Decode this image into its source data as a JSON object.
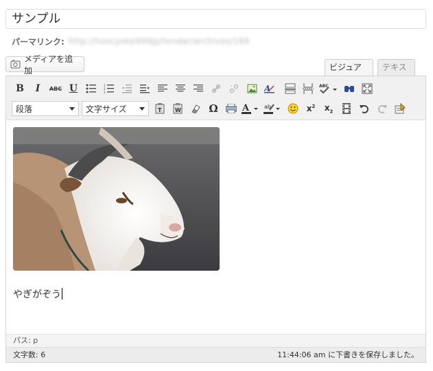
{
  "post": {
    "title": "サンプル",
    "permalink_label": "パーマリンク:",
    "permalink_url": "http://hoscyoke999jp/tendar/archives/189"
  },
  "media": {
    "add_label": "メディアを追加"
  },
  "tabs": {
    "visual": "ビジュアル",
    "text": "テキスト"
  },
  "toolbar": {
    "format_select": "段落",
    "fontsize_select": "文字サイズ",
    "row1_icons": [
      "bold-icon",
      "italic-icon",
      "strikethrough-icon",
      "underline-icon",
      "bullet-list-icon",
      "numbered-list-icon",
      "outdent-icon",
      "indent-icon",
      "align-left-icon",
      "align-center-icon",
      "align-right-icon",
      "link-icon",
      "unlink-icon",
      "image-icon",
      "anchor-icon",
      "hr-icon",
      "page-break-icon",
      "spellcheck-icon",
      "find-icon",
      "fullscreen-icon"
    ],
    "row2_icons": [
      "paste-text-icon",
      "paste-word-icon",
      "remove-format-icon",
      "special-char-icon",
      "print-icon",
      "text-color-icon",
      "highlight-color-icon",
      "emoticon-icon",
      "superscript-icon",
      "subscript-icon",
      "media-embed-icon",
      "undo-icon",
      "redo-icon",
      "wp-help-icon"
    ]
  },
  "editor": {
    "image_alt": "ヤギの写真",
    "body_text": "やぎがぞう"
  },
  "path": {
    "label": "パス: p"
  },
  "status": {
    "word_count": "文字数: 6",
    "autosave": "11:44:06 am に下書きを保存しました。"
  }
}
